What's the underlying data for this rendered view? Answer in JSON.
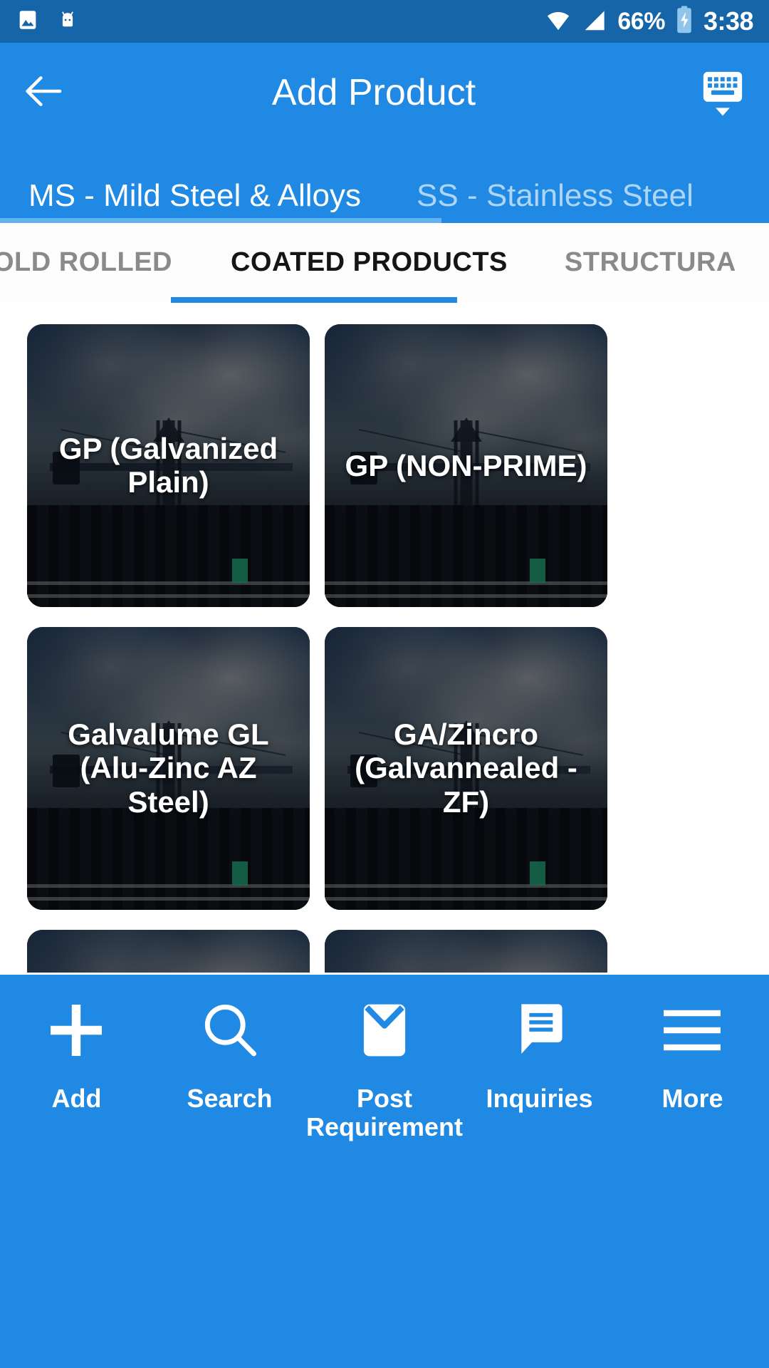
{
  "status_bar": {
    "icons": [
      "image-icon",
      "android-head-icon",
      "wifi-icon",
      "cellular-signal-icon",
      "battery-charging-icon"
    ],
    "battery_percent": "66%",
    "time": "3:38"
  },
  "app_bar": {
    "back_icon": "back-arrow-icon",
    "title": "Add Product",
    "keyboard_icon": "hide-keyboard-icon"
  },
  "category_tabs": {
    "items": [
      {
        "label": "MS - Mild Steel & Alloys",
        "active": true
      },
      {
        "label": "SS - Stainless Steel",
        "active": false
      }
    ]
  },
  "sub_tabs": {
    "items": [
      {
        "label": "OLD ROLLED",
        "active": false
      },
      {
        "label": "COATED PRODUCTS",
        "active": true
      },
      {
        "label": "STRUCTURA",
        "active": false
      }
    ]
  },
  "product_grid": {
    "cards": [
      {
        "label": "GP (Galvanized Plain)"
      },
      {
        "label": "GP (NON-PRIME)"
      },
      {
        "label": "Galvalume GL (Alu-Zinc AZ Steel)"
      },
      {
        "label": "GA/Zincro (Galvannealed -ZF)"
      },
      {
        "label": ""
      },
      {
        "label": ""
      }
    ]
  },
  "bottom_nav": {
    "items": [
      {
        "label": "Add",
        "icon": "plus-icon"
      },
      {
        "label": "Search",
        "icon": "search-icon"
      },
      {
        "label": "Post\nRequirement",
        "icon": "envelope-icon"
      },
      {
        "label": "Inquiries",
        "icon": "chat-bubble-icon"
      },
      {
        "label": "More",
        "icon": "hamburger-menu-icon"
      }
    ]
  },
  "colors": {
    "status_bar": "#1565A8",
    "app_bar": "#2089E3",
    "accent": "#2089E3",
    "tab_indicator": "#62B1F0",
    "inactive_tab": "#ADD6F6",
    "inactive_subtab": "#8A8A8A"
  }
}
